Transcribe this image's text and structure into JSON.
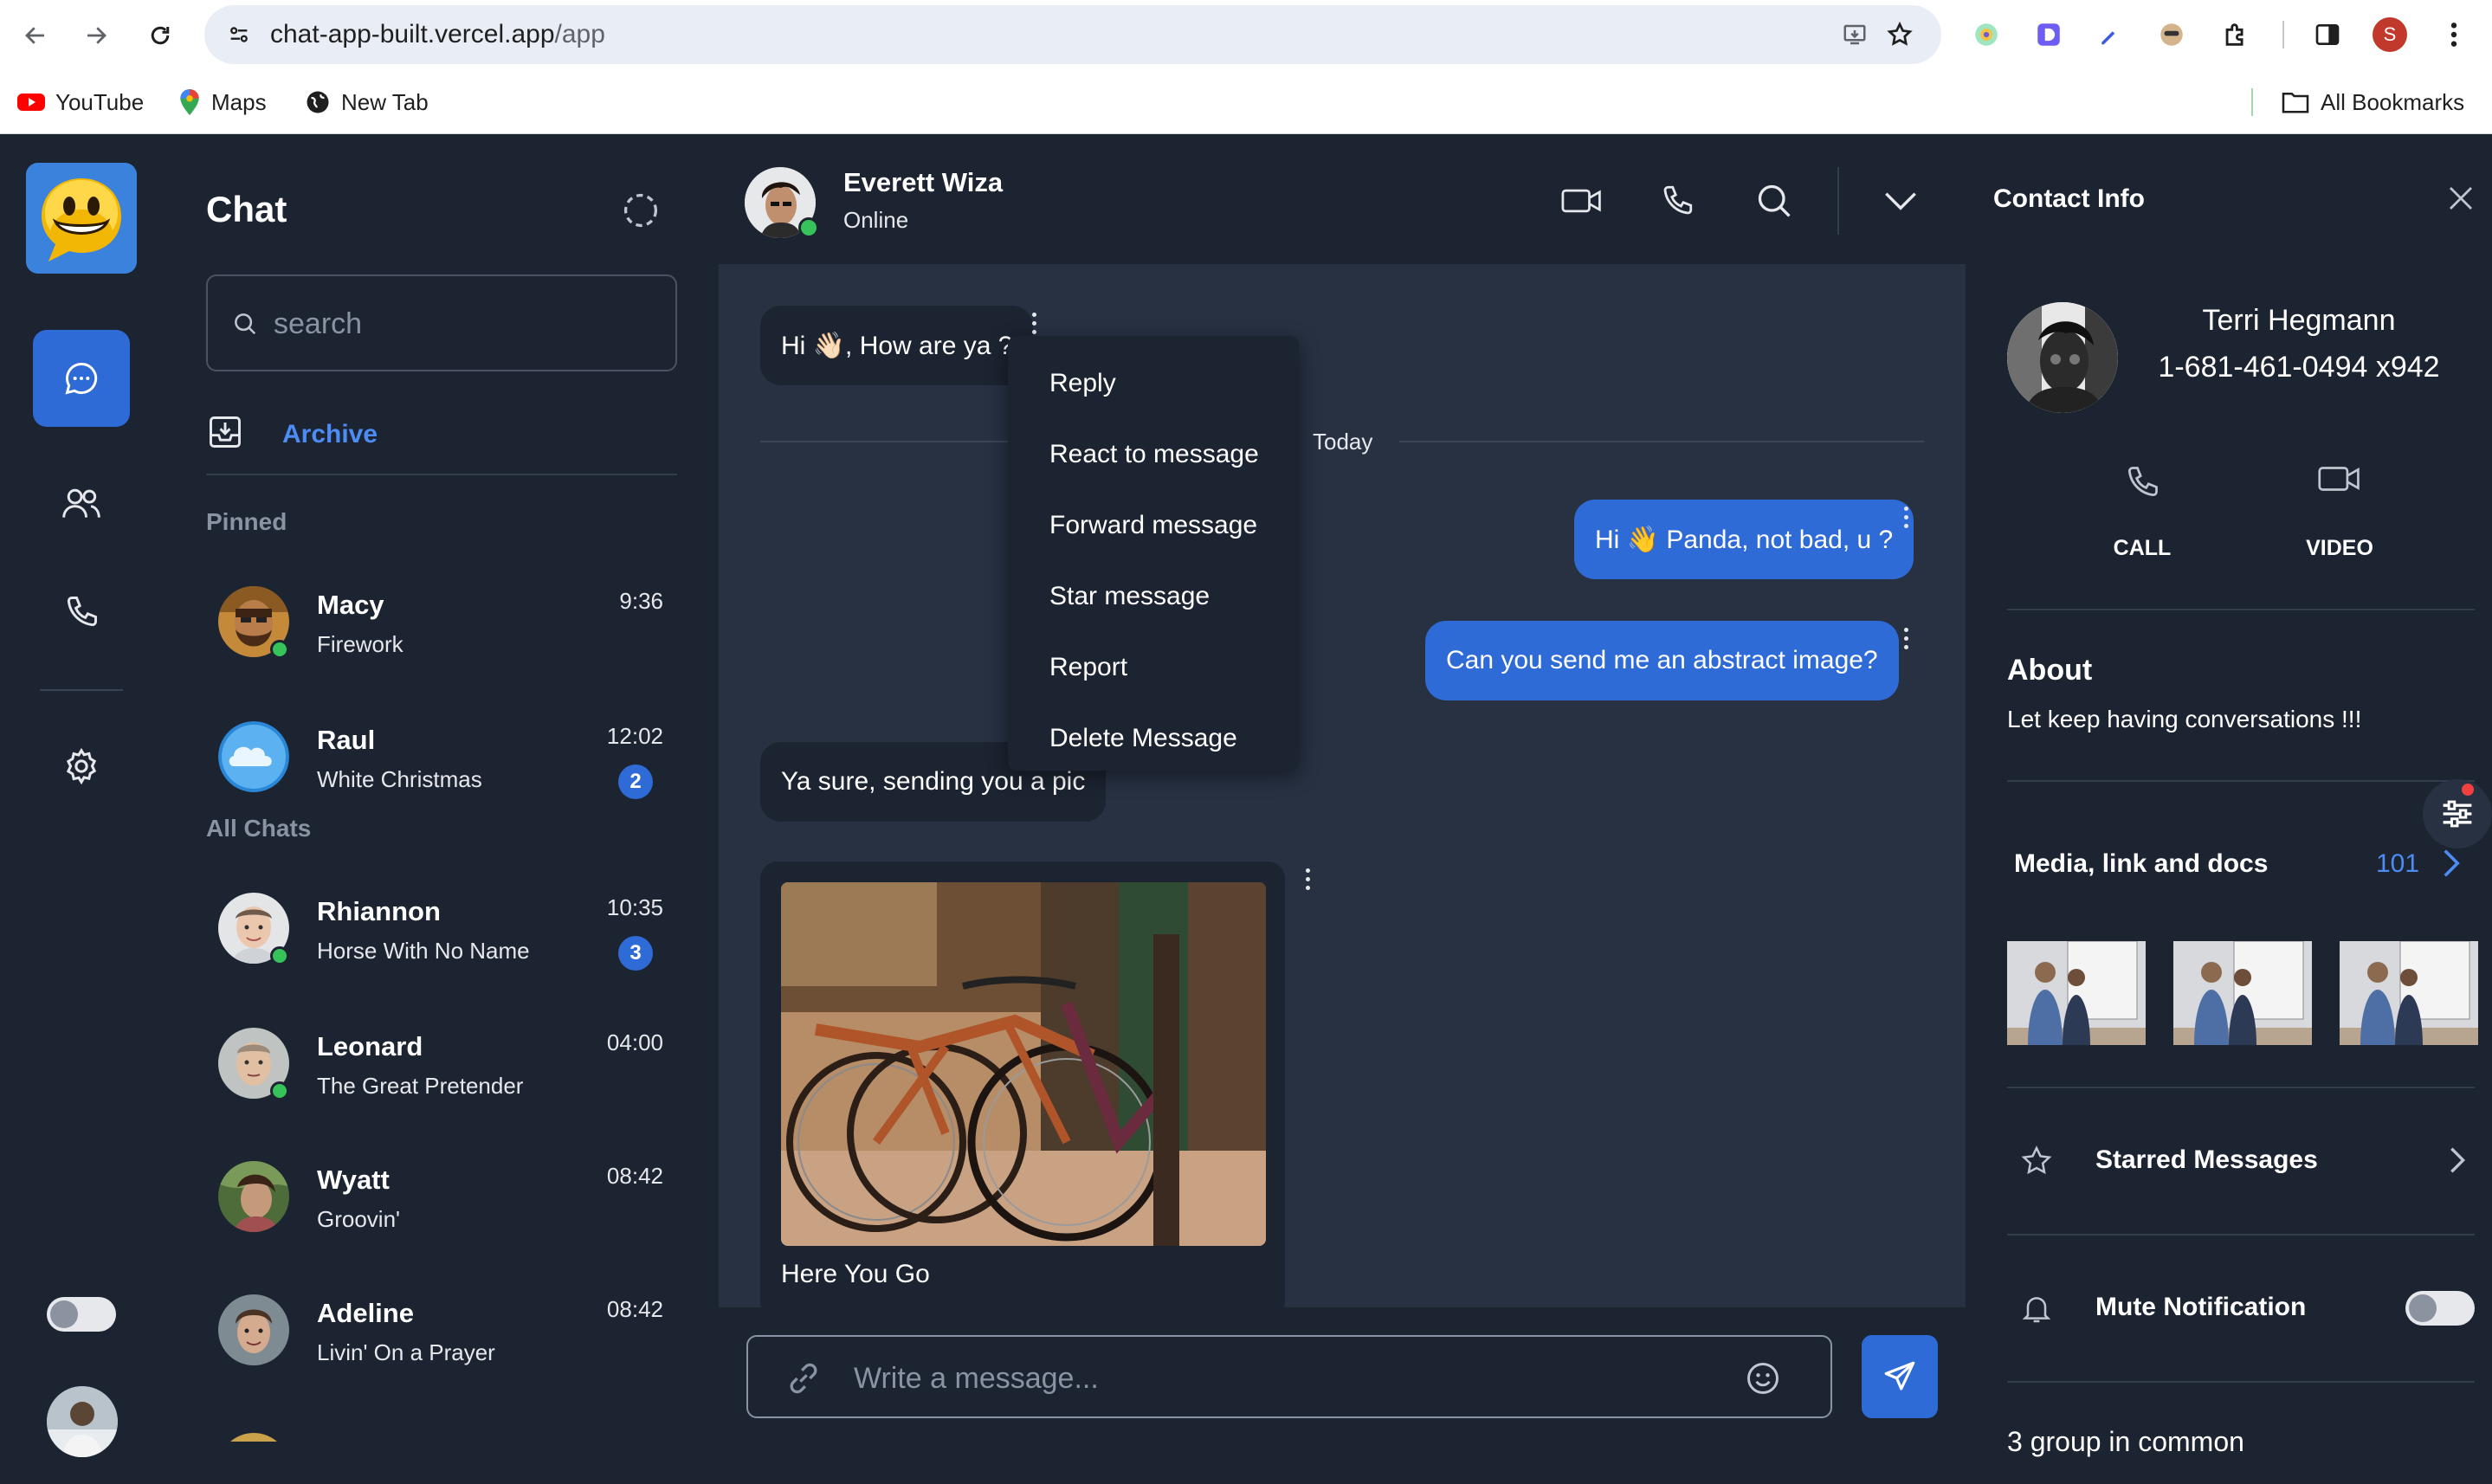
{
  "browser": {
    "url_host": "chat-app-built.vercel.app",
    "url_path": "/app",
    "profile_initial": "S",
    "bookmarks": [
      {
        "label": "YouTube",
        "icon": "youtube-icon"
      },
      {
        "label": "Maps",
        "icon": "maps-icon"
      },
      {
        "label": "New Tab",
        "icon": "globe-icon"
      }
    ],
    "all_bookmarks_label": "All Bookmarks"
  },
  "sidebar": {
    "title": "Chat",
    "search": {
      "placeholder": "search",
      "value": ""
    },
    "archive_label": "Archive",
    "pinned_label": "Pinned",
    "all_chats_label": "All Chats",
    "pinned": [
      {
        "name": "Macy",
        "message": "Firework",
        "time": "9:36",
        "online": true,
        "unread": null
      },
      {
        "name": "Raul",
        "message": "White Christmas",
        "time": "12:02",
        "online": false,
        "unread": "2"
      }
    ],
    "chats": [
      {
        "name": "Rhiannon",
        "message": "Horse With No Name",
        "time": "10:35",
        "online": true,
        "unread": "3"
      },
      {
        "name": "Leonard",
        "message": "The Great Pretender",
        "time": "04:00",
        "online": true,
        "unread": null
      },
      {
        "name": "Wyatt",
        "message": "Groovin'",
        "time": "08:42",
        "online": false,
        "unread": null
      },
      {
        "name": "Adeline",
        "message": "Livin' On a Prayer",
        "time": "08:42",
        "online": false,
        "unread": null
      }
    ]
  },
  "conversation": {
    "contact_name": "Everett Wiza",
    "status": "Online",
    "divider_label": "Today",
    "messages": [
      {
        "direction": "incoming",
        "text": "Hi 👋🏻, How are ya ?"
      },
      {
        "direction": "outgoing",
        "text": "Hi 👋 Panda, not bad, u ?"
      },
      {
        "direction": "outgoing",
        "text": "Can you send me an abstract image?"
      },
      {
        "direction": "incoming",
        "text": "Ya sure, sending you a pic"
      },
      {
        "direction": "incoming",
        "type": "image",
        "caption": "Here You Go"
      }
    ],
    "context_menu": [
      "Reply",
      "React to message",
      "Forward message",
      "Star message",
      "Report",
      "Delete Message"
    ],
    "composer": {
      "placeholder": "Write a message...",
      "value": ""
    }
  },
  "contact_info": {
    "title": "Contact Info",
    "name": "Terri Hegmann",
    "phone": "1-681-461-0494 x942",
    "call_label": "CALL",
    "video_label": "VIDEO",
    "about_title": "About",
    "about_text": "Let keep having conversations !!!",
    "media_label": "Media, link and docs",
    "media_count": "101",
    "starred_label": "Starred Messages",
    "mute_label": "Mute Notification",
    "mute_enabled": false,
    "groups_text": "3 group in common"
  },
  "colors": {
    "accent": "#2e6bd6",
    "link": "#4d8cf5",
    "online": "#35c35a",
    "panel": "#1c2431",
    "canvas": "#273142"
  }
}
